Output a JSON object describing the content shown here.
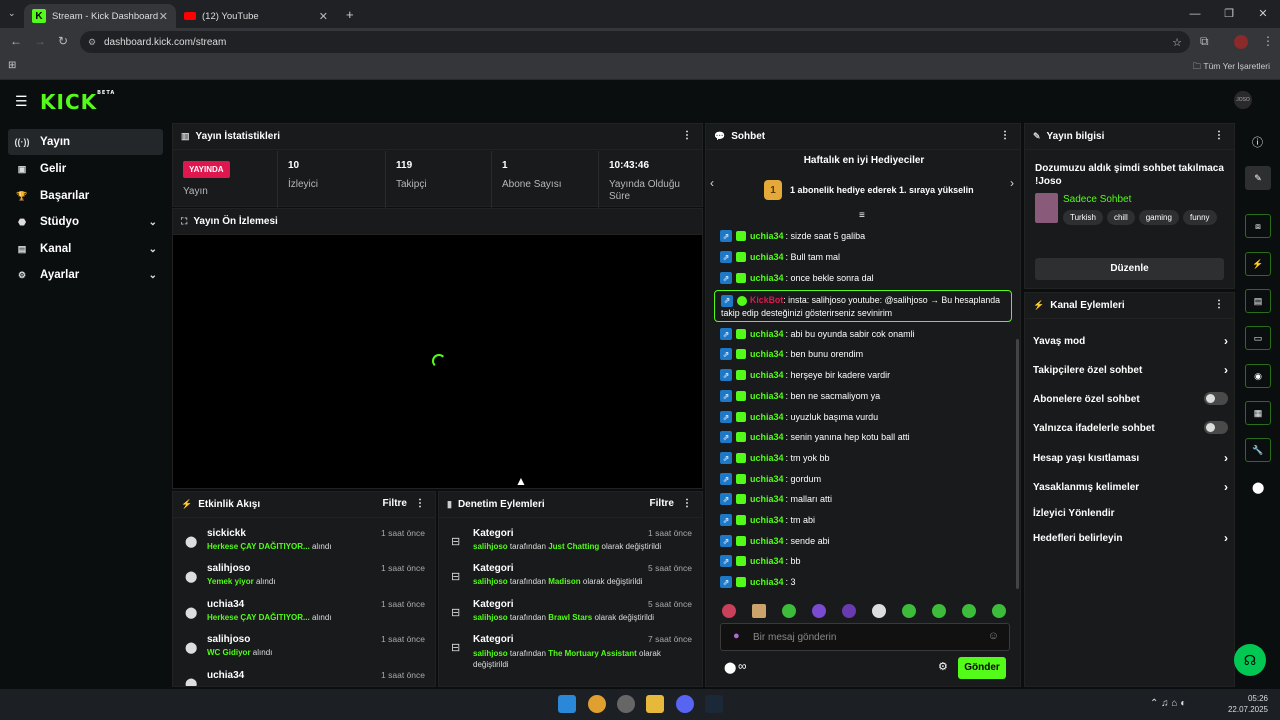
{
  "browser": {
    "tabs": [
      {
        "title": "Stream - Kick Dashboard"
      },
      {
        "title": "(12) YouTube"
      }
    ],
    "url": "dashboard.kick.com/stream",
    "bookmarks_label": "Tüm Yer İşaretleri"
  },
  "header": {
    "logo": "KICK",
    "logo_badge": "BETA",
    "avatar_text": "JOSO"
  },
  "sidebar": {
    "items": [
      {
        "label": "Yayın",
        "icon": "broadcast-icon"
      },
      {
        "label": "Gelir",
        "icon": "wallet-icon"
      },
      {
        "label": "Başarılar",
        "icon": "trophy-icon"
      },
      {
        "label": "Stüdyo",
        "icon": "studio-icon"
      },
      {
        "label": "Kanal",
        "icon": "channel-icon"
      },
      {
        "label": "Ayarlar",
        "icon": "gear-icon"
      }
    ]
  },
  "stats": {
    "title": "Yayın İstatistikleri",
    "live_badge": "YAYINDA",
    "live_label": "Yayın",
    "cells": [
      {
        "value": "10",
        "label": "İzleyici"
      },
      {
        "value": "119",
        "label": "Takipçi"
      },
      {
        "value": "1",
        "label": "Abone Sayısı"
      },
      {
        "value": "10:43:46",
        "label": "Yayında Olduğu Süre"
      }
    ]
  },
  "preview": {
    "title": "Yayın Ön İzlemesi"
  },
  "activity": {
    "title": "Etkinlik Akışı",
    "filter": "Filtre",
    "items": [
      {
        "name": "sickickk",
        "reward": "Herkese ÇAY DAĞITIYOR...",
        "suffix": "alındı",
        "time": "1 saat önce"
      },
      {
        "name": "salihjoso",
        "reward": "Yemek yiyor",
        "suffix": "alındı",
        "time": "1 saat önce"
      },
      {
        "name": "uchia34",
        "reward": "Herkese ÇAY DAĞITIYOR...",
        "suffix": "alındı",
        "time": "1 saat önce"
      },
      {
        "name": "salihjoso",
        "reward": "WC Gidiyor",
        "suffix": "alındı",
        "time": "1 saat önce"
      },
      {
        "name": "uchia34",
        "reward": "",
        "suffix": "",
        "time": "1 saat önce"
      }
    ]
  },
  "moderation": {
    "title": "Denetim Eylemleri",
    "filter": "Filtre",
    "items": [
      {
        "name": "Kategori",
        "user": "salihjoso",
        "mid": "tarafından",
        "target": "Just Chatting",
        "suffix": "olarak değiştirildi",
        "time": "1 saat önce"
      },
      {
        "name": "Kategori",
        "user": "salihjoso",
        "mid": "tarafından",
        "target": "Madison",
        "suffix": "olarak değiştirildi",
        "time": "5 saat önce"
      },
      {
        "name": "Kategori",
        "user": "salihjoso",
        "mid": "tarafından",
        "target": "Brawl Stars",
        "suffix": "olarak değiştirildi",
        "time": "5 saat önce"
      },
      {
        "name": "Kategori",
        "user": "salihjoso",
        "mid": "tarafından",
        "target": "The Mortuary Assistant",
        "suffix": "olarak değiştirildi",
        "time": "7 saat önce"
      }
    ]
  },
  "chat": {
    "title": "Sohbet",
    "gifters_title": "Haftalık en iyi Hediyeciler",
    "gifters_rank": "1",
    "gifters_text": "1 abonelik hediye ederek 1. sıraya yükselin",
    "messages": [
      {
        "user": "uchia34",
        "text": "sizde saat 5 galiba"
      },
      {
        "user": "uchia34",
        "text": "Bull tam mal"
      },
      {
        "user": "uchia34",
        "text": "once bekle sonra dal"
      },
      {
        "user": "uchia34",
        "text": "abi bu oyunda sabir cok onamli"
      },
      {
        "user": "uchia34",
        "text": "ben bunu orendim"
      },
      {
        "user": "uchia34",
        "text": "herşeye bir kadere vardir"
      },
      {
        "user": "uchia34",
        "text": "ben ne sacmaliyom ya"
      },
      {
        "user": "uchia34",
        "text": "uyuzluk başıma vurdu"
      },
      {
        "user": "uchia34",
        "text": "senin yanına hep kotu ball atti"
      },
      {
        "user": "uchia34",
        "text": "tm yok bb"
      },
      {
        "user": "uchia34",
        "text": "gordum"
      },
      {
        "user": "uchia34",
        "text": "malları atti"
      },
      {
        "user": "uchia34",
        "text": "tm abi"
      },
      {
        "user": "uchia34",
        "text": "sende abi"
      },
      {
        "user": "uchia34",
        "text": "bb"
      },
      {
        "user": "uchia34",
        "text": "3"
      }
    ],
    "bot": {
      "user": "KickBot",
      "text": "insta: salihjoso youtube: @salihjoso → Bu hesaplanda takip edip desteğinizi gösterirseniz sevinirim"
    },
    "input_placeholder": "Bir mesaj gönderin",
    "send_label": "Gönder"
  },
  "stream_info": {
    "title": "Yayın bilgisi",
    "stream_title": "Dozumuzu aldık şimdi sohbet takılmaca !Joso",
    "category": "Sadece Sohbet",
    "tags": [
      "Turkish",
      "chill",
      "gaming",
      "funny"
    ],
    "edit_label": "Düzenle"
  },
  "channel_actions": {
    "title": "Kanal Eylemleri",
    "items": [
      {
        "label": "Yavaş mod",
        "control": "chevron"
      },
      {
        "label": "Takipçilere özel sohbet",
        "control": "chevron"
      },
      {
        "label": "Abonelere özel sohbet",
        "control": "toggle"
      },
      {
        "label": "Yalnızca ifadelerle sohbet",
        "control": "toggle"
      },
      {
        "label": "Hesap yaşı kısıtlaması",
        "control": "chevron"
      },
      {
        "label": "Yasaklanmış kelimeler",
        "control": "chevron"
      },
      {
        "label": "İzleyici Yönlendir",
        "control": "none"
      },
      {
        "label": "Hedefleri belirleyin",
        "control": "chevron"
      }
    ]
  },
  "taskbar": {
    "time": "05:26",
    "date": "22.07.2025"
  },
  "colors": {
    "accent": "#53fc18",
    "live": "#e0164e",
    "panel": "#181a1b",
    "background": "#0b0e0f"
  }
}
